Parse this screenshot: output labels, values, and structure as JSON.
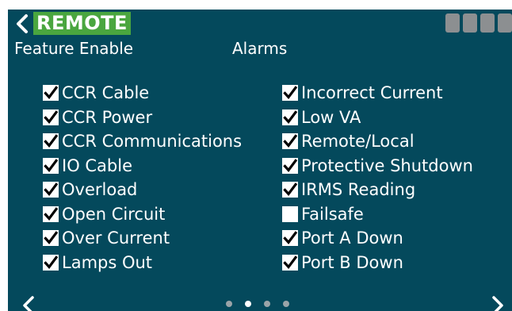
{
  "header": {
    "title": "REMOTE",
    "back_icon": "chevron-left-icon",
    "status_indicator_count": 4,
    "colors": {
      "background": "#04495c",
      "title_badge": "#4aa63f",
      "status_square": "#8c8f91"
    }
  },
  "sections": {
    "feature_label": "Feature Enable",
    "alarms_label": "Alarms"
  },
  "feature_items": [
    {
      "label": "CCR Cable",
      "checked": true
    },
    {
      "label": "CCR Power",
      "checked": true
    },
    {
      "label": "CCR Communications",
      "checked": true
    },
    {
      "label": "IO Cable",
      "checked": true
    },
    {
      "label": "Overload",
      "checked": true
    },
    {
      "label": "Open Circuit",
      "checked": true
    },
    {
      "label": "Over Current",
      "checked": true
    },
    {
      "label": "Lamps Out",
      "checked": true
    }
  ],
  "alarm_items": [
    {
      "label": "Incorrect Current",
      "checked": true
    },
    {
      "label": "Low VA",
      "checked": true
    },
    {
      "label": "Remote/Local",
      "checked": true
    },
    {
      "label": "Protective Shutdown",
      "checked": true
    },
    {
      "label": "IRMS Reading",
      "checked": true
    },
    {
      "label": "Failsafe",
      "checked": false
    },
    {
      "label": "Port A Down",
      "checked": true
    },
    {
      "label": "Port B Down",
      "checked": true
    }
  ],
  "pager": {
    "page_count": 4,
    "current_page": 2,
    "prev_icon": "chevron-left-icon",
    "next_icon": "chevron-right-icon"
  }
}
